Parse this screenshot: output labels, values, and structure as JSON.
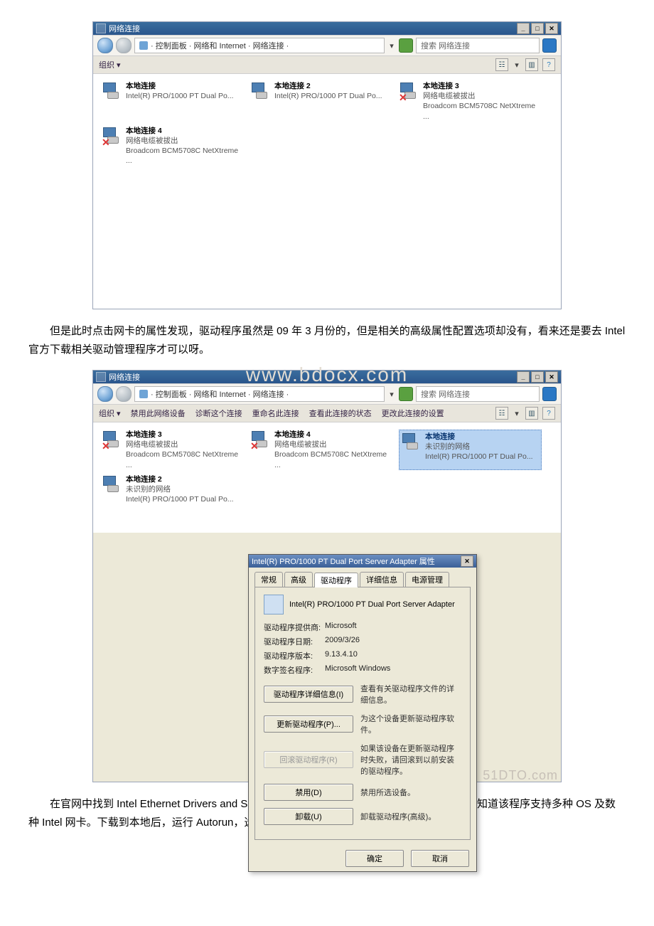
{
  "screenshot1": {
    "title": "网络连接",
    "win_min": "_",
    "win_max": "□",
    "win_close": "✕",
    "path": "· 控制面板 · 网络和 Internet · 网络连接 ·",
    "search_placeholder": "搜索 网络连接",
    "organize": "组织 ▾",
    "conns": [
      {
        "name": "本地连接",
        "sub": "Intel(R) PRO/1000 PT Dual Po...",
        "err": false
      },
      {
        "name": "本地连接 2",
        "sub": "Intel(R) PRO/1000 PT Dual Po...",
        "err": false
      },
      {
        "name": "本地连接 3",
        "status": "网络电缆被拔出",
        "sub": "Broadcom BCM5708C NetXtreme ...",
        "err": true
      },
      {
        "name": "本地连接 4",
        "status": "网络电缆被拔出",
        "sub": "Broadcom BCM5708C NetXtreme ...",
        "err": true
      }
    ]
  },
  "para1": "但是此时点击网卡的属性发现，驱动程序虽然是 09 年 3 月份的，但是相关的高级属性配置选项却没有，看来还是要去 Intel 官方下载相关驱动管理程序才可以呀。",
  "screenshot2": {
    "title": "网络连接",
    "win_min": "_",
    "win_max": "□",
    "win_close": "✕",
    "path": "· 控制面板 · 网络和 Internet · 网络连接 ·",
    "search_placeholder": "搜索 网络连接",
    "organize": "组织 ▾",
    "tools": [
      "禁用此网络设备",
      "诊断这个连接",
      "重命名此连接",
      "查看此连接的状态",
      "更改此连接的设置"
    ],
    "conns": [
      {
        "name": "本地连接 3",
        "status": "网络电缆被拔出",
        "sub": "Broadcom BCM5708C NetXtreme ...",
        "err": true
      },
      {
        "name": "本地连接 4",
        "status": "网络电缆被拔出",
        "sub": "Broadcom BCM5708C NetXtreme ...",
        "err": true
      },
      {
        "name": "本地连接",
        "status": "未识别的网络",
        "sub": "Intel(R) PRO/1000 PT Dual Po...",
        "err": false,
        "sel": true
      },
      {
        "name": "本地连接 2",
        "status": "未识别的网络",
        "sub": "Intel(R) PRO/1000 PT Dual Po...",
        "err": false
      }
    ],
    "dialog": {
      "title": "Intel(R) PRO/1000 PT Dual Port Server Adapter 属性",
      "win_close": "✕",
      "tabs": [
        "常规",
        "高级",
        "驱动程序",
        "详细信息",
        "电源管理"
      ],
      "active_tab": "驱动程序",
      "device": "Intel(R) PRO/1000 PT Dual Port Server Adapter",
      "rows": [
        {
          "k": "驱动程序提供商:",
          "v": "Microsoft"
        },
        {
          "k": "驱动程序日期:",
          "v": "2009/3/26"
        },
        {
          "k": "驱动程序版本:",
          "v": "9.13.4.10"
        },
        {
          "k": "数字签名程序:",
          "v": "Microsoft Windows"
        }
      ],
      "actions": [
        {
          "btn": "驱动程序详细信息(I)",
          "desc": "查看有关驱动程序文件的详细信息。",
          "dis": false
        },
        {
          "btn": "更新驱动程序(P)...",
          "desc": "为这个设备更新驱动程序软件。",
          "dis": false
        },
        {
          "btn": "回滚驱动程序(R)",
          "desc": "如果该设备在更新驱动程序时失败，请回滚到以前安装的驱动程序。",
          "dis": true
        },
        {
          "btn": "禁用(D)",
          "desc": "禁用所选设备。",
          "dis": false
        },
        {
          "btn": "卸载(U)",
          "desc": "卸载驱动程序(高级)。",
          "dis": false
        }
      ],
      "ok": "确定",
      "cancel": "取消"
    },
    "watermark": "51DTO.com",
    "watermark2": "www.bdocx.com"
  },
  "para2": "在官网中找到 Intel Ethernet Drivers and Software for Multiple Operating Systems 从描述中知道该程序支持多种 OS 及数种 Intel 网卡。下载到本地后，运行 Autorun，选择【安装驱动程序和软件】"
}
